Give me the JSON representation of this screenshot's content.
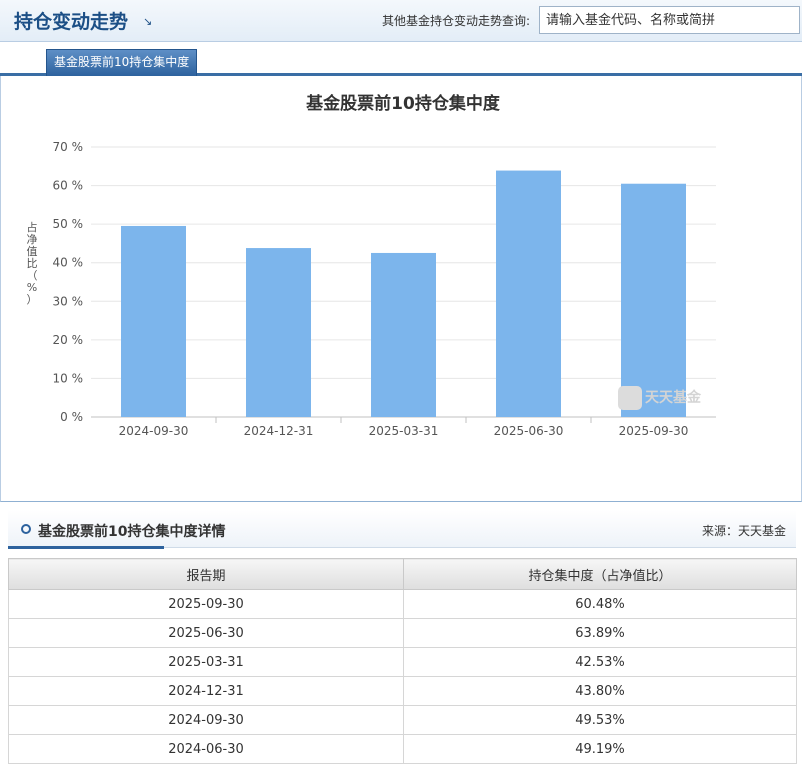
{
  "header": {
    "title": "持仓变动走势",
    "arrow": "↘",
    "search_label": "其他基金持仓变动走势查询:",
    "search_placeholder": "请输入基金代码、名称或简拼"
  },
  "tabs": [
    {
      "label": "基金股票前10持仓集中度",
      "active": true
    }
  ],
  "chart_data": {
    "type": "bar",
    "title": "基金股票前10持仓集中度",
    "ylabel": "占净值比（%）",
    "categories": [
      "2024-09-30",
      "2024-12-31",
      "2025-03-31",
      "2025-06-30",
      "2025-09-30"
    ],
    "values": [
      49.53,
      43.8,
      42.53,
      63.89,
      60.48
    ],
    "ylim": [
      0,
      70
    ],
    "yticks": [
      "0 %",
      "10 %",
      "20 %",
      "30 %",
      "40 %",
      "50 %",
      "60 %",
      "70 %"
    ],
    "grid": true,
    "bar_color": "#7cb5ec",
    "watermark": "天天基金"
  },
  "detail": {
    "title": "基金股票前10持仓集中度详情",
    "source": "来源：天天基金",
    "columns": [
      "报告期",
      "持仓集中度（占净值比）"
    ],
    "rows": [
      [
        "2025-09-30",
        "60.48%"
      ],
      [
        "2025-06-30",
        "63.89%"
      ],
      [
        "2025-03-31",
        "42.53%"
      ],
      [
        "2024-12-31",
        "43.80%"
      ],
      [
        "2024-09-30",
        "49.53%"
      ],
      [
        "2024-06-30",
        "49.19%"
      ]
    ]
  }
}
